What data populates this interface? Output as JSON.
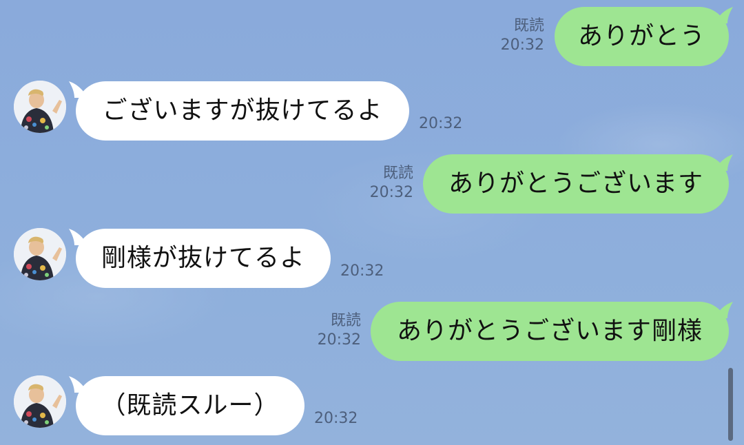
{
  "messages": [
    {
      "direction": "out",
      "text": "ありがとう",
      "read_label": "既読",
      "time": "20:32"
    },
    {
      "direction": "in",
      "text": "ございますが抜けてるよ",
      "time": "20:32",
      "avatar": "avatar-icon"
    },
    {
      "direction": "out",
      "text": "ありがとうございます",
      "read_label": "既読",
      "time": "20:32"
    },
    {
      "direction": "in",
      "text": "剛様が抜けてるよ",
      "time": "20:32",
      "avatar": "avatar-icon"
    },
    {
      "direction": "out",
      "text": "ありがとうございます剛様",
      "read_label": "既読",
      "time": "20:32"
    },
    {
      "direction": "in",
      "text": "（既読スルー）",
      "time": "20:32",
      "avatar": "avatar-icon"
    }
  ],
  "colors": {
    "background": "#8eaddb",
    "outgoing_bubble": "#9ee592",
    "incoming_bubble": "#ffffff",
    "meta_text": "#4d5f7c"
  }
}
